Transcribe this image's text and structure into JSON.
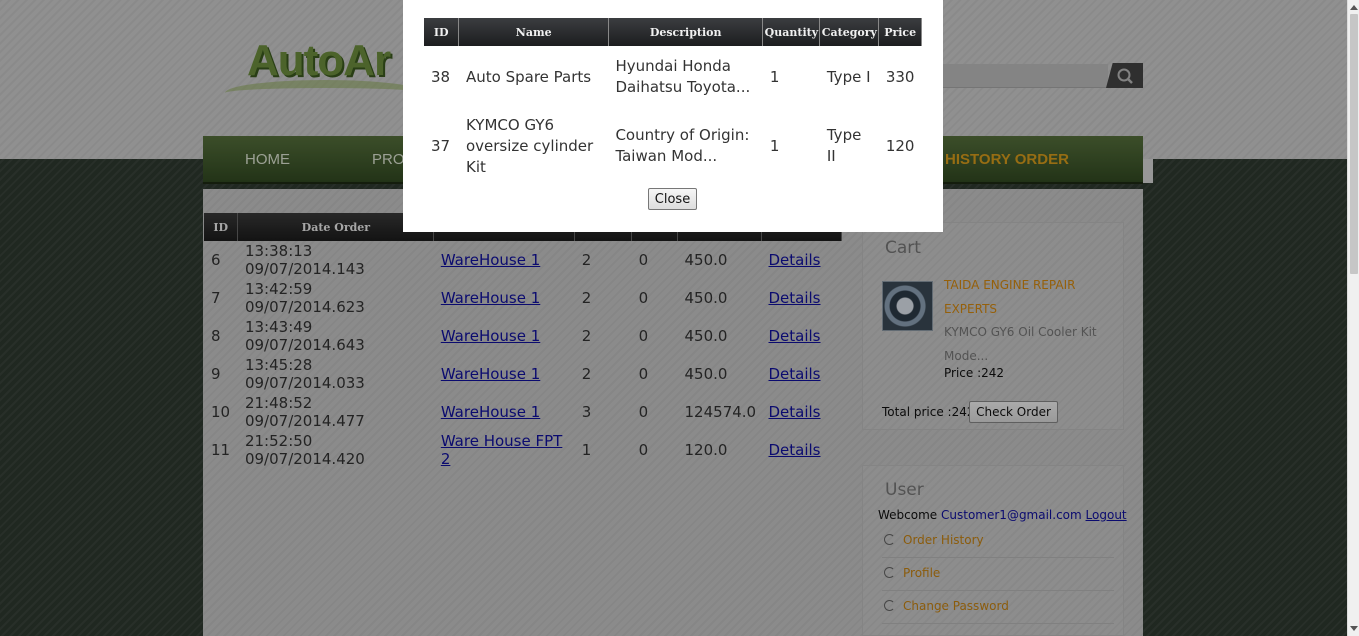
{
  "header": {
    "logo_text": "AutoAr",
    "nav": [
      "HOME",
      "PRO",
      "HISTORY ORDER"
    ]
  },
  "orders": {
    "columns": [
      "ID",
      "Date Order",
      "",
      "",
      "",
      "",
      ""
    ],
    "rows": [
      {
        "id": "6",
        "date": "13:38:13 09/07/2014.143",
        "warehouse": "WareHouse 1",
        "qty": "2",
        "status": "0",
        "total": "450.0",
        "details": "Details"
      },
      {
        "id": "7",
        "date": "13:42:59 09/07/2014.623",
        "warehouse": "WareHouse 1",
        "qty": "2",
        "status": "0",
        "total": "450.0",
        "details": "Details"
      },
      {
        "id": "8",
        "date": "13:43:49 09/07/2014.643",
        "warehouse": "WareHouse 1",
        "qty": "2",
        "status": "0",
        "total": "450.0",
        "details": "Details"
      },
      {
        "id": "9",
        "date": "13:45:28 09/07/2014.033",
        "warehouse": "WareHouse 1",
        "qty": "2",
        "status": "0",
        "total": "450.0",
        "details": "Details"
      },
      {
        "id": "10",
        "date": "21:48:52 09/07/2014.477",
        "warehouse": "WareHouse 1",
        "qty": "3",
        "status": "0",
        "total": "124574.0",
        "details": "Details"
      },
      {
        "id": "11",
        "date": "21:52:50 09/07/2014.420",
        "warehouse": "Ware House FPT 2",
        "qty": "1",
        "status": "0",
        "total": "120.0",
        "details": "Details"
      }
    ]
  },
  "cart": {
    "title": "Cart",
    "item_name": "TAIDA ENGINE REPAIR EXPERTS",
    "item_desc": "KYMCO GY6 Oil Cooler Kit Mode...",
    "item_price": "Price :242",
    "total": "Total price :242",
    "check_button": "Check Order"
  },
  "user": {
    "title": "User",
    "welcome": "Webcome",
    "email": "Customer1@gmail.com",
    "logout": "Logout",
    "links": [
      "Order History",
      "Profile",
      "Change Password"
    ]
  },
  "modal": {
    "columns": [
      "ID",
      "Name",
      "Description",
      "Quantity",
      "Category",
      "Price"
    ],
    "rows": [
      {
        "id": "38",
        "name": "Auto Spare Parts",
        "description": "Hyundai Honda Daihatsu Toyota...",
        "quantity": "1",
        "category": "Type I",
        "price": "330"
      },
      {
        "id": "37",
        "name": "KYMCO GY6 oversize cylinder Kit",
        "description": "Country of Origin: Taiwan Mod...",
        "quantity": "1",
        "category": "Type II",
        "price": "120"
      }
    ],
    "close_label": "Close"
  },
  "colors": {
    "accent": "#d99c1c",
    "link": "#1010a0",
    "nav_bg": "#324a22",
    "table_header": "#1c1c1c"
  }
}
